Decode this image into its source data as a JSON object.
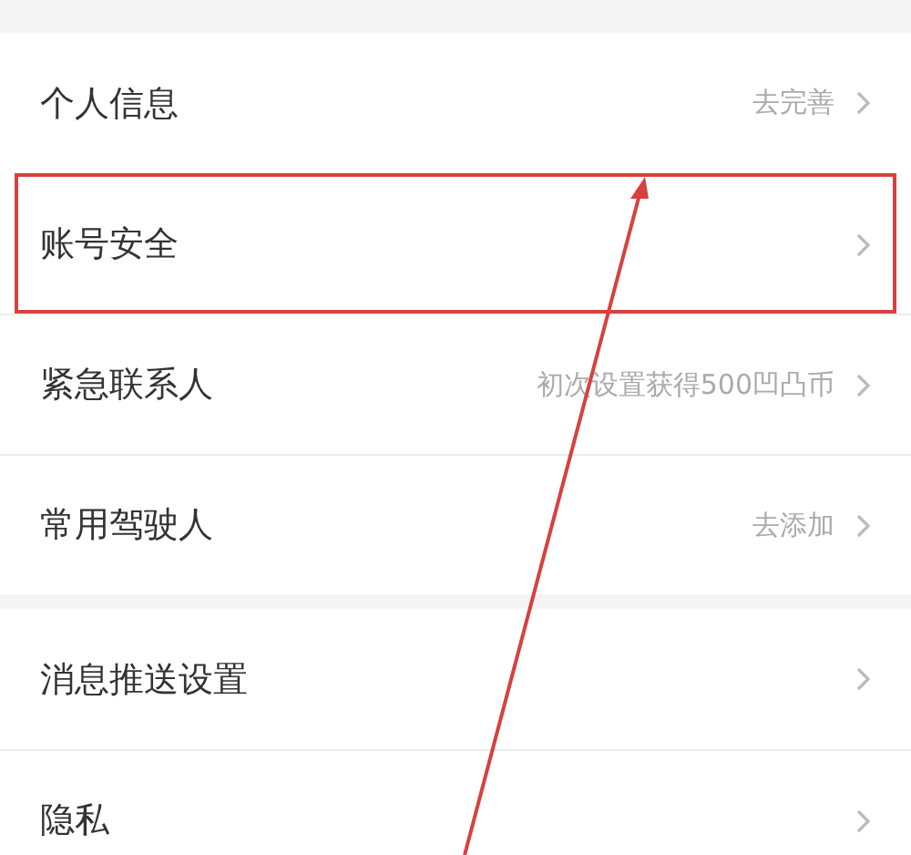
{
  "sections": [
    {
      "items": [
        {
          "label": "个人信息",
          "value": "去完善",
          "highlighted": false
        },
        {
          "label": "账号安全",
          "highlighted": true
        },
        {
          "label": "紧急联系人",
          "value": "初次设置获得500凹凸币",
          "highlighted": false
        },
        {
          "label": "常用驾驶人",
          "value": "去添加",
          "highlighted": false
        }
      ]
    },
    {
      "items": [
        {
          "label": "消息推送设置",
          "highlighted": false
        },
        {
          "label": "隐私",
          "highlighted": false
        }
      ]
    }
  ]
}
